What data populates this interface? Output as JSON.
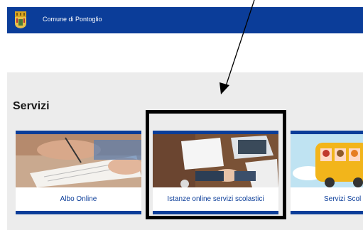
{
  "header": {
    "site_name": "Comune di Pontoglio",
    "brand_color": "#0b3d99"
  },
  "section": {
    "title": "Servizi"
  },
  "cards": [
    {
      "label": "Albo Online",
      "image": "signing-document-photo"
    },
    {
      "label": "Istanze online servizi scolastici",
      "image": "handshake-desk-photo"
    },
    {
      "label": "Servizi Scol",
      "image": "school-bus-illustration"
    }
  ],
  "annotation": {
    "type": "arrow-and-box",
    "color": "#000000"
  }
}
